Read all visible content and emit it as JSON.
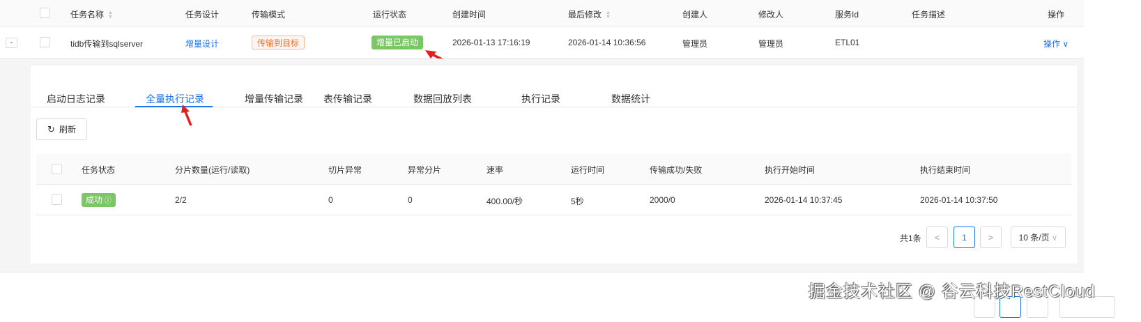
{
  "table": {
    "headers": [
      "任务名称",
      "任务设计",
      "传输模式",
      "运行状态",
      "创建时间",
      "最后修改",
      "创建人",
      "修改人",
      "服务Id",
      "任务描述",
      "操作"
    ],
    "row": {
      "expand": "-",
      "name": "tidb传输到sqlserver",
      "design": "增量设计",
      "mode": "传输到目标",
      "status": "增量已启动",
      "created": "2026-01-13 17:16:19",
      "modified": "2026-01-14 10:36:56",
      "creator": "管理员",
      "modifier": "管理员",
      "service_id": "ETL01",
      "desc": "",
      "action": "操作"
    }
  },
  "tabs": [
    "启动日志记录",
    "全量执行记录",
    "增量传输记录",
    "表传输记录",
    "数据回放列表",
    "执行记录",
    "数据统计"
  ],
  "refresh_label": "刷新",
  "inner": {
    "headers": [
      "任务状态",
      "分片数量(运行/读取)",
      "切片异常",
      "异常分片",
      "速率",
      "运行时间",
      "传输成功/失败",
      "执行开始时间",
      "执行结束时间"
    ],
    "row": {
      "status": "成功",
      "shards": "2/2",
      "slice_err": "0",
      "err_shards": "0",
      "rate": "400.00/秒",
      "runtime": "5秒",
      "success_fail": "2000/0",
      "start": "2026-01-14 10:37:45",
      "end": "2026-01-14 10:37:50"
    }
  },
  "pagination": {
    "total": "共1条",
    "page": "1",
    "prev": "<",
    "next": ">",
    "size": "10 条/页"
  },
  "watermark": "掘金技术社区 @ 谷云科技RestCloud",
  "colors": {
    "accent": "#1a73e8",
    "success": "#7cc765",
    "warn": "#f56c2b",
    "arrow": "#e02020"
  }
}
